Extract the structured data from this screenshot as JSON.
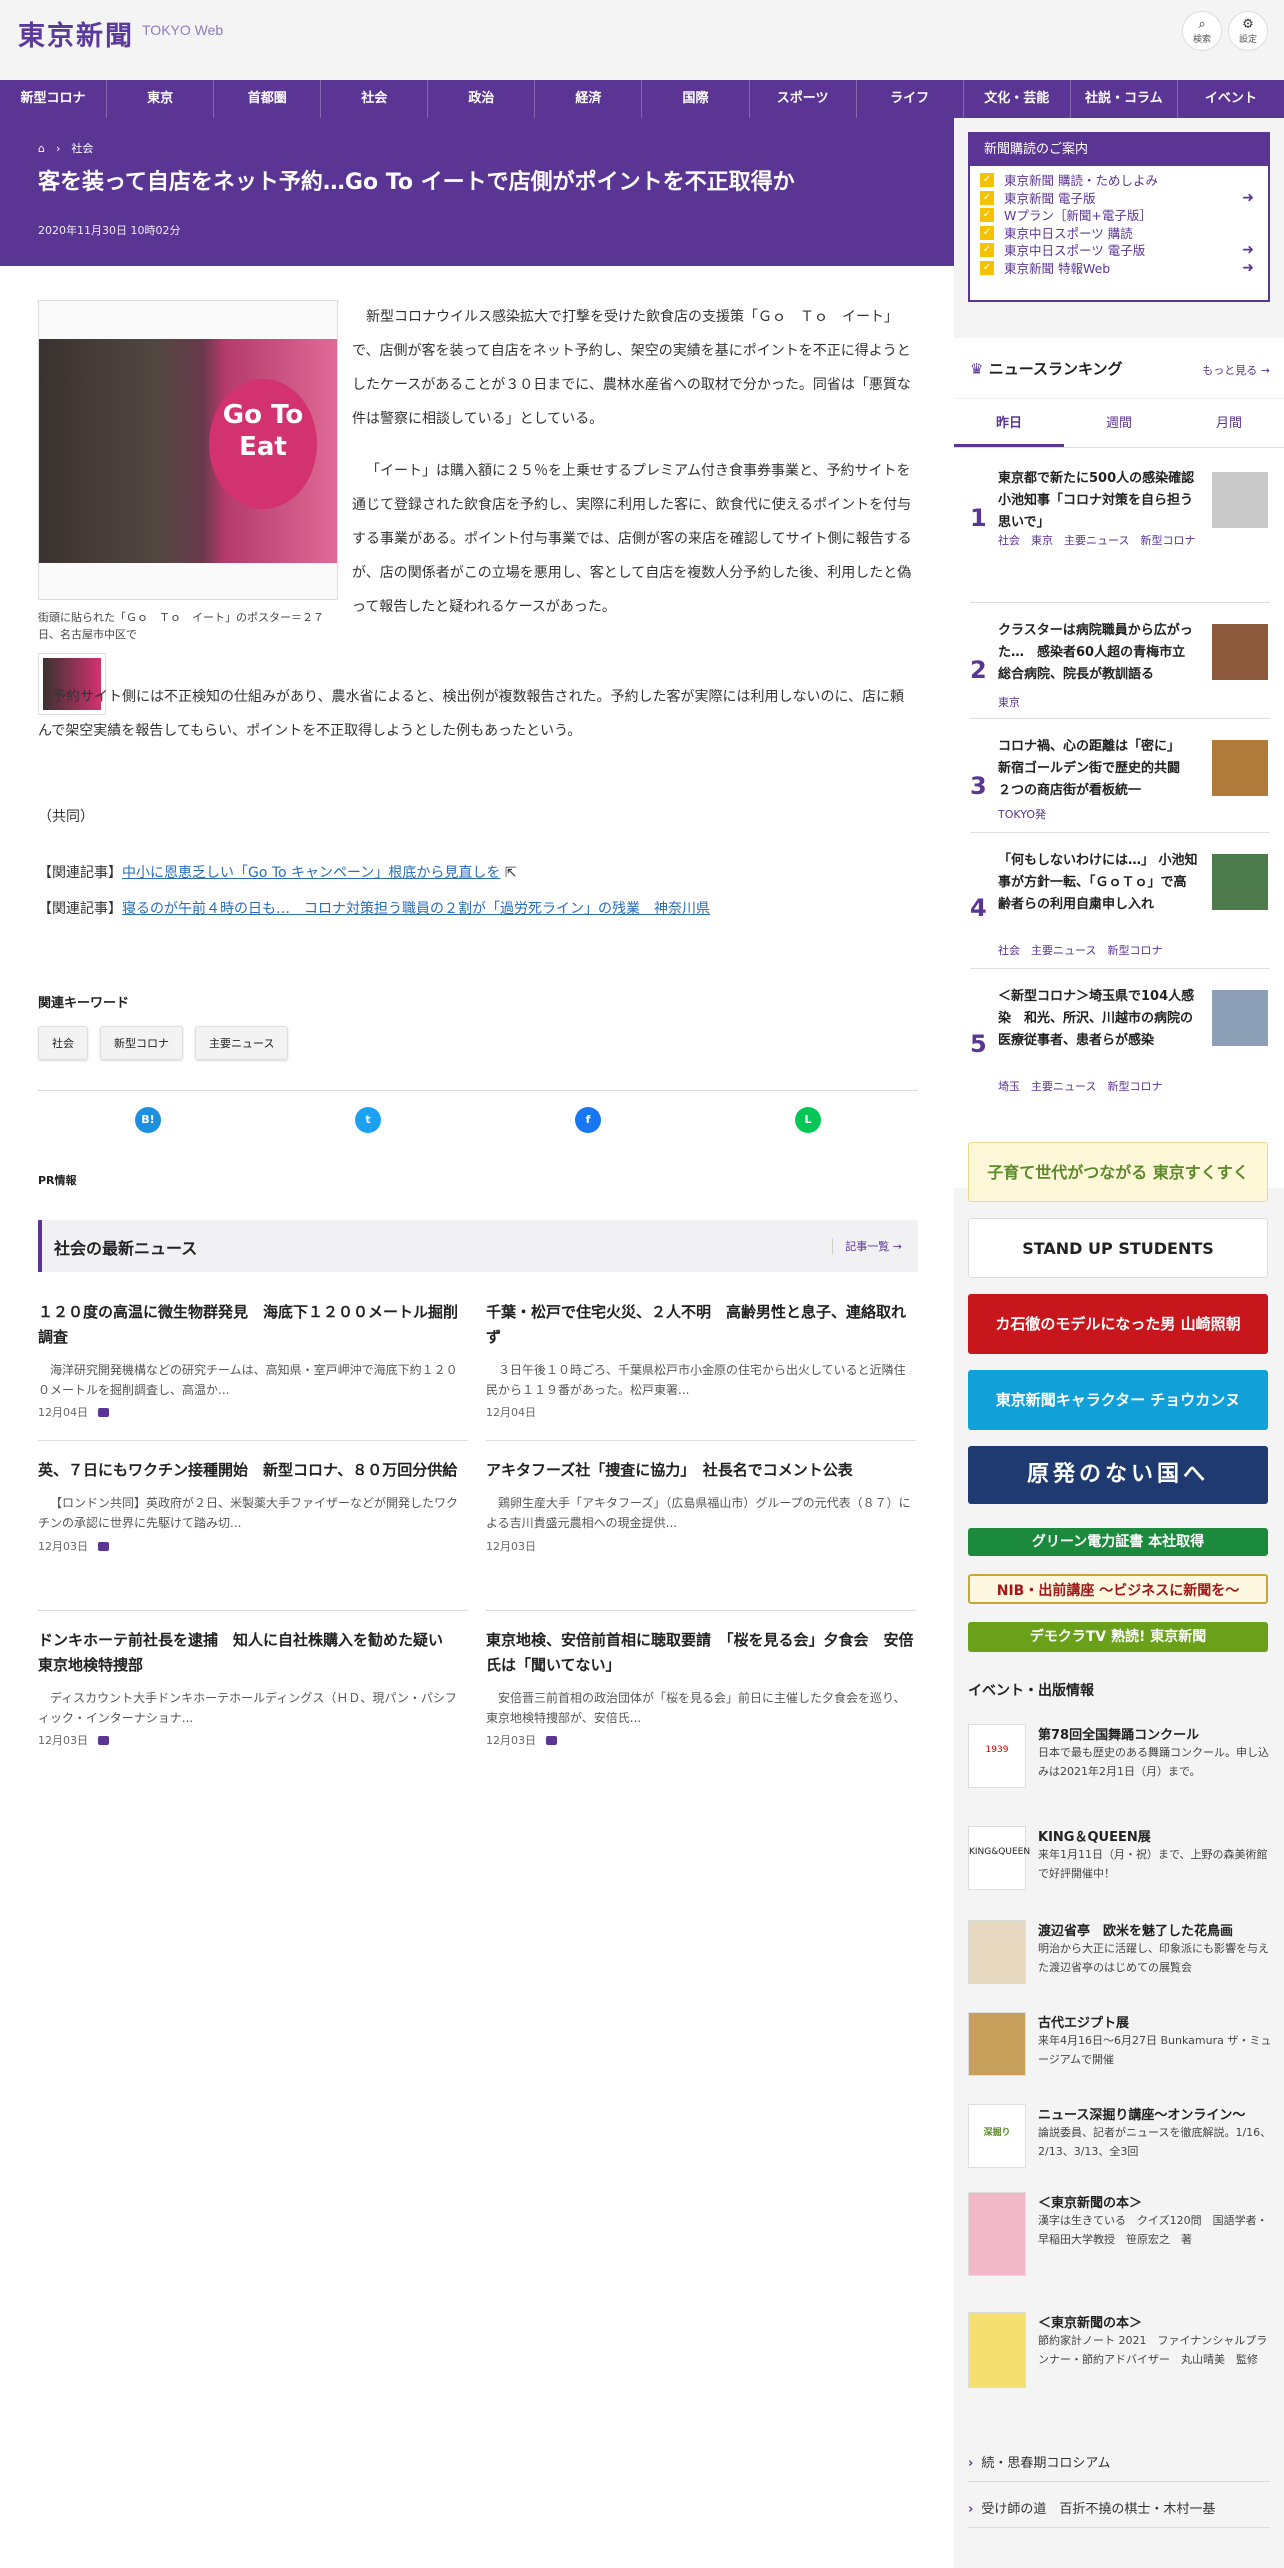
{
  "header": {
    "logo": "東京新聞",
    "logo_en": "TOKYO Web",
    "search_label": "検索",
    "settings_label": "設定"
  },
  "nav": [
    "新型コロナ",
    "東京",
    "首都圏",
    "社会",
    "政治",
    "経済",
    "国際",
    "スポーツ",
    "ライフ",
    "文化・芸能",
    "社説・コラム",
    "イベント"
  ],
  "breadcrumb": {
    "home_icon": "home-icon",
    "section": "社会"
  },
  "article": {
    "title": "客を装って自店をネット予約…Go To イートで店側がポイントを不正取得か",
    "date": "2020年11月30日 10時02分",
    "photo_text": "Go To Eat",
    "caption": "街頭に貼られた「Ｇｏ　Ｔｏ　イート」のポスター＝２７日、名古屋市中区で",
    "p1": "新型コロナウイルス感染拡大で打撃を受けた飲食店の支援策「Ｇｏ　Ｔｏ　イート」で、店側が客を装って自店をネット予約し、架空の実績を基にポイントを不正に得ようとしたケースがあることが３０日までに、農林水産省への取材で分かった。同省は「悪質な件は警察に相談している」としている。",
    "p2": "「イート」は購入額に２５％を上乗せするプレミアム付き食事券事業と、予約サイトを通じて登録された飲食店を予約し、実際に利用した客に、飲食代に使えるポイントを付与する事業がある。ポイント付与事業では、店側が客の来店を確認してサイト側に報告するが、店の関係者がこの立場を悪用し、客として自店を複数人分予約した後、利用したと偽って報告したと疑われるケースがあった。",
    "p3": "予約サイト側には不正検知の仕組みがあり、農水省によると、検出例が複数報告された。予約した客が実際には利用しないのに、店に頼んで架空実績を報告してもらい、ポイントを不正取得しようとした例もあったという。",
    "credit": "（共同）",
    "related": [
      {
        "prefix": "【関連記事】",
        "link": "中小に恩恵乏しい「Go To キャンペーン」根底から見直しを"
      },
      {
        "prefix": "【関連記事】",
        "link": "寝るのが午前４時の日も…　コロナ対策担う職員の２割が「過労死ライン」の残業　神奈川県"
      }
    ],
    "keywords_heading": "関連キーワード",
    "keywords": [
      "社会",
      "新型コロナ",
      "主要ニュース"
    ],
    "share": [
      "B!",
      "t",
      "f",
      "L"
    ],
    "pr": "PR情報"
  },
  "latest": {
    "title": "社会の最新ニュース",
    "more": "記事一覧",
    "items": [
      {
        "title": "１２０度の高温に微生物群発見　海底下１２００メートル掘削調査",
        "lead": "海洋研究開発機構などの研究チームは、高知県・室戸岬沖で海底下約１２００メートルを掘削調査し、高温か...",
        "date": "12月04日"
      },
      {
        "title": "千葉・松戸で住宅火災、２人不明　高齢男性と息子、連絡取れず",
        "lead": "３日午後１０時ごろ、千葉県松戸市小金原の住宅から出火していると近隣住民から１１９番があった。松戸東署...",
        "date": "12月04日"
      },
      {
        "title": "英、７日にもワクチン接種開始　新型コロナ、８０万回分供給",
        "lead": "【ロンドン共同】英政府が２日、米製薬大手ファイザーなどが開発したワクチンの承認に世界に先駆けて踏み切...",
        "date": "12月03日"
      },
      {
        "title": "アキタフーズ社「捜査に協力」　社長名でコメント公表",
        "lead": "鶏卵生産大手「アキタフーズ」（広島県福山市）グループの元代表（８７）による吉川貴盛元農相への現金提供...",
        "date": "12月03日"
      },
      {
        "title": "ドンキホーテ前社長を逮捕　知人に自社株購入を勧めた疑い　東京地検特捜部",
        "lead": "ディスカウント大手ドンキホーテホールディングス（ＨＤ、現パン・パシフィック・インターナショナ...",
        "date": "12月03日"
      },
      {
        "title": "東京地検、安倍前首相に聴取要請　「桜を見る会」夕食会　安倍氏は「聞いてない」",
        "lead": "安倍晋三前首相の政治団体が「桜を見る会」前日に主催した夕食会を巡り、東京地検特捜部が、安倍氏...",
        "date": "12月03日"
      }
    ]
  },
  "subscribe": {
    "title": "新聞購読のご案内",
    "items": [
      "東京新聞 購読・ためしよみ",
      "東京新聞 電子版",
      "Wプラン［新聞+電子版］",
      "東京中日スポーツ 購読",
      "東京中日スポーツ 電子版",
      "東京新聞 特報Web"
    ]
  },
  "ranking": {
    "title": "ニュースランキング",
    "more": "もっと見る",
    "tabs": [
      "昨日",
      "週間",
      "月間"
    ],
    "items": [
      {
        "num": "1",
        "title": "東京都で新たに500人の感染確認　小池知事「コロナ対策を自ら担う思いで」",
        "tags": "社会　東京　主要ニュース　新型コロナ"
      },
      {
        "num": "2",
        "title": "クラスターは病院職員から広がった…　感染者60人超の青梅市立総合病院、院長が教訓語る",
        "tags": "東京"
      },
      {
        "num": "3",
        "title": "コロナ禍、心の距離は「密に」　新宿ゴールデン街で歴史的共闘　２つの商店街が看板統一",
        "tags": "TOKYO発"
      },
      {
        "num": "4",
        "title": "「何もしないわけには…」 小池知事が方針一転、「ＧｏＴｏ」で高齢者らの利用自粛申し入れ",
        "tags": "社会　主要ニュース　新型コロナ"
      },
      {
        "num": "5",
        "title": "＜新型コロナ＞埼玉県で104人感染　和光、所沢、川越市の病院の医療従事者、患者らが感染",
        "tags": "埼玉　主要ニュース　新型コロナ"
      }
    ]
  },
  "banners": [
    "子育て世代がつながる 東京すくすく",
    "STAND UP STUDENTS",
    "カ石徹のモデルになった男 山崎照朝",
    "東京新聞キャラクター チョウカンヌ",
    "原発のない国へ",
    "グリーン電力証書 本社取得",
    "NIB・出前講座 ～ビジネスに新聞を～",
    "デモクラTV 熟読! 東京新聞"
  ],
  "events": {
    "heading": "イベント・出版情報",
    "items": [
      {
        "title": "第78回全国舞踊コンクール",
        "desc": "日本で最も歴史のある舞踊コンクール。申し込みは2021年2月1日（月）まで。",
        "badge": "1939"
      },
      {
        "title": "KING＆QUEEN展",
        "desc": "来年1月11日（月・祝）まで、上野の森美術館で好評開催中！",
        "badge": "KING&QUEEN"
      },
      {
        "title": "渡辺省亭　欧米を魅了した花鳥画",
        "desc": "明治から大正に活躍し、印象派にも影響を与えた渡辺省亭のはじめての展覧会",
        "badge": ""
      },
      {
        "title": "古代エジプト展",
        "desc": "来年4月16日～6月27日 Bunkamura ザ・ミュージアムで開催",
        "badge": ""
      },
      {
        "title": "ニュース深掘り講座～オンライン～",
        "desc": "論説委員、記者がニュースを徹底解説。1/16、2/13、3/13、全3回",
        "badge": "深掘り"
      },
      {
        "title": "＜東京新聞の本＞",
        "desc": "漢字は生きている　クイズ120問　国語学者・早稲田大学教授　笹原宏之　著",
        "badge": ""
      },
      {
        "title": "＜東京新聞の本＞",
        "desc": "節約家計ノート 2021　ファイナンシャルプランナー・節約アドバイザー　丸山晴美　監修",
        "badge": ""
      }
    ]
  },
  "side_links": [
    "続・思春期コロシアム",
    "受け師の道　百折不撓の棋士・木村一基"
  ],
  "colors": {
    "brand": "#5b3594",
    "accent": "#f5c200",
    "link": "#2a6ebb"
  }
}
